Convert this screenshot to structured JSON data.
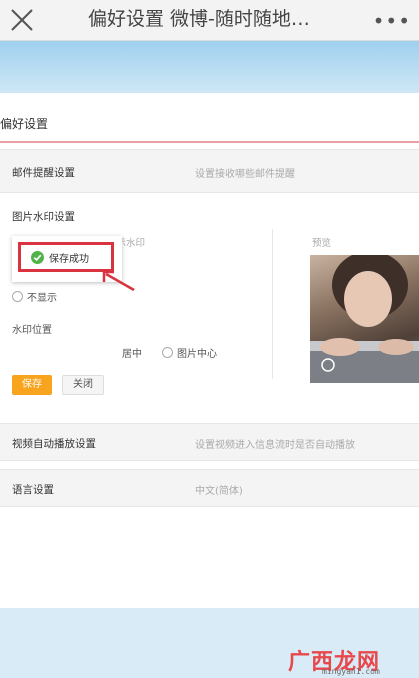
{
  "header": {
    "title": "偏好设置 微博-随时随地…"
  },
  "card": {
    "title": "偏好设置"
  },
  "mail": {
    "label": "邮件提醒设置",
    "desc": "设置接收哪些邮件提醒"
  },
  "watermark": {
    "title": "图片水印设置",
    "desc": "设置是否在微博图片上显示水印",
    "show_label": "显示",
    "hide_label": "不显示",
    "selected": "显示",
    "position_label": "水印位置",
    "opt_center": "居中",
    "opt_image_center": "图片中心",
    "preview_label": "预览",
    "save_label": "保存",
    "close_label": "关闭"
  },
  "toast": {
    "text": "保存成功"
  },
  "video": {
    "label": "视频自动播放设置",
    "desc": "设置视频进入信息流时是否自动播放"
  },
  "language": {
    "label": "语言设置",
    "value": "中文(简体)"
  },
  "watermark_site": {
    "text": "广西龙网",
    "url": "mingyan1.com"
  },
  "colors": {
    "accent": "#f8a41e",
    "highlight": "#d9333f",
    "banner": "#9fd0ee"
  },
  "icons": {
    "close": "close-icon",
    "more": "more-icon",
    "check": "check-icon"
  }
}
